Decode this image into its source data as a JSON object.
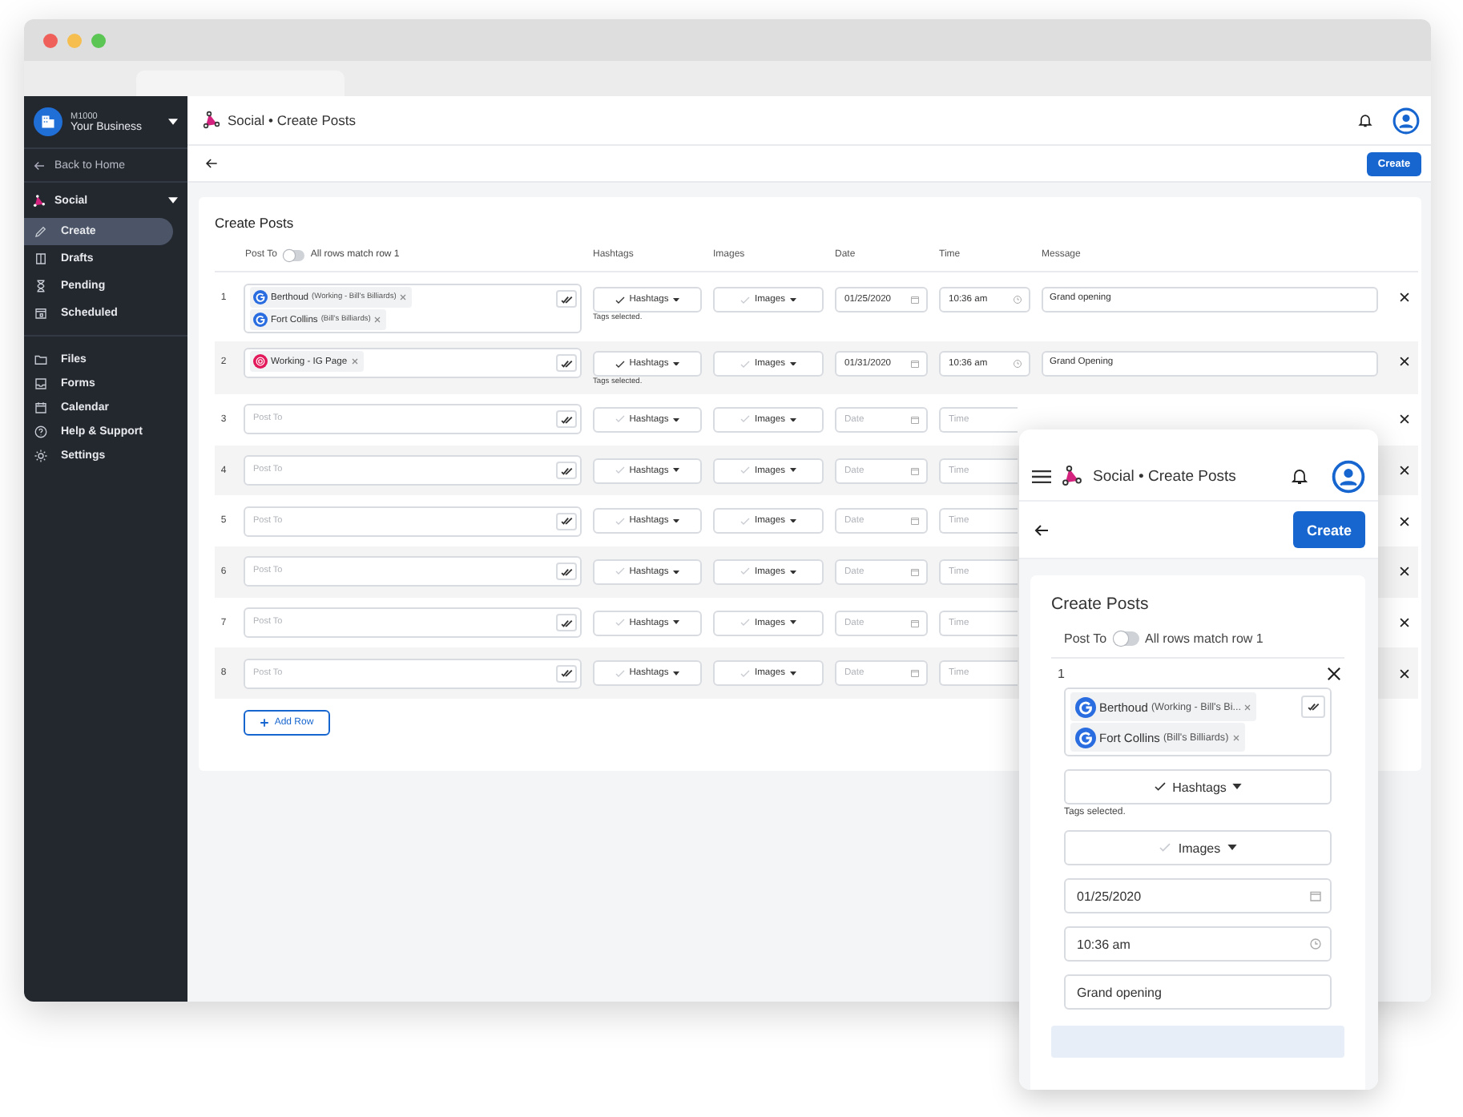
{
  "sidebar": {
    "business": {
      "code": "M1000",
      "name": "Your Business"
    },
    "back_link": "Back to Home",
    "section": "Social",
    "items": [
      {
        "label": "Create",
        "selected": true
      },
      {
        "label": "Drafts",
        "selected": false
      },
      {
        "label": "Pending",
        "selected": false
      },
      {
        "label": "Scheduled",
        "selected": false
      }
    ],
    "links": [
      "Files",
      "Forms",
      "Calendar",
      "Help & Support",
      "Settings"
    ]
  },
  "header": {
    "title": "Social • Create Posts"
  },
  "toolbar": {
    "create_button": "Create"
  },
  "posts": {
    "title": "Create Posts",
    "columns": {
      "post_to": "Post To",
      "hashtags": "Hashtags",
      "images": "Images",
      "date": "Date",
      "time": "Time",
      "message": "Message"
    },
    "match_toggle": {
      "label": "All rows match row 1",
      "on": false
    },
    "rows": [
      {
        "number": "1",
        "accounts": [
          {
            "kind": "google",
            "name": "Berthoud",
            "detail": "(Working - Bill's Billiards)"
          },
          {
            "kind": "google",
            "name": "Fort Collins",
            "detail": "(Bill's Billiards)"
          }
        ],
        "hashtags": {
          "label": "Hashtags",
          "checked": true
        },
        "tags_note": "Tags selected.",
        "images": {
          "label": "Images",
          "checked": false
        },
        "date": {
          "value": "01/25/2020"
        },
        "time": {
          "value": "10:36 am"
        },
        "message": {
          "value": "Grand opening"
        }
      },
      {
        "number": "2",
        "accounts": [
          {
            "kind": "instagram",
            "name": "Working - IG Page"
          }
        ],
        "hashtags": {
          "label": "Hashtags",
          "checked": true
        },
        "tags_note": "Tags selected.",
        "images": {
          "label": "Images",
          "checked": false
        },
        "date": {
          "value": "01/31/2020"
        },
        "time": {
          "value": "10:36 am"
        },
        "message": {
          "value": "Grand Opening"
        }
      },
      {
        "number": "3",
        "post_to_placeholder": "Post To",
        "hashtags": {
          "label": "Hashtags",
          "checked": false
        },
        "images": {
          "label": "Images",
          "checked": false
        },
        "date": {
          "placeholder": "Date"
        },
        "time": {
          "placeholder": "Time"
        }
      },
      {
        "number": "4",
        "post_to_placeholder": "Post To",
        "hashtags": {
          "label": "Hashtags",
          "checked": false
        },
        "images": {
          "label": "Images",
          "checked": false
        },
        "date": {
          "placeholder": "Date"
        },
        "time": {
          "placeholder": "Time"
        }
      },
      {
        "number": "5",
        "post_to_placeholder": "Post To",
        "hashtags": {
          "label": "Hashtags",
          "checked": false
        },
        "images": {
          "label": "Images",
          "checked": false
        },
        "date": {
          "placeholder": "Date"
        },
        "time": {
          "placeholder": "Time"
        }
      },
      {
        "number": "6",
        "post_to_placeholder": "Post To",
        "hashtags": {
          "label": "Hashtags",
          "checked": false
        },
        "images": {
          "label": "Images",
          "checked": false
        },
        "date": {
          "placeholder": "Date"
        },
        "time": {
          "placeholder": "Time"
        }
      },
      {
        "number": "7",
        "post_to_placeholder": "Post To",
        "hashtags": {
          "label": "Hashtags",
          "checked": false
        },
        "images": {
          "label": "Images",
          "checked": false
        },
        "date": {
          "placeholder": "Date"
        },
        "time": {
          "placeholder": "Time"
        }
      },
      {
        "number": "8",
        "post_to_placeholder": "Post To",
        "hashtags": {
          "label": "Hashtags",
          "checked": false
        },
        "images": {
          "label": "Images",
          "checked": false
        },
        "date": {
          "placeholder": "Date"
        },
        "time": {
          "placeholder": "Time"
        }
      }
    ],
    "add_row": "Add Row"
  },
  "mobile": {
    "title": "Social • Create Posts",
    "create_button": "Create",
    "card_title": "Create Posts",
    "post_to": "Post To",
    "match_toggle": {
      "label": "All rows match row 1",
      "on": false
    },
    "row": {
      "number": "1",
      "accounts": [
        {
          "kind": "google",
          "name": "Berthoud",
          "detail": "(Working - Bill's Bi..."
        },
        {
          "kind": "google",
          "name": "Fort Collins",
          "detail": "(Bill's Billiards)"
        }
      ],
      "hashtags": {
        "label": "Hashtags",
        "checked": true
      },
      "tags_note": "Tags selected.",
      "images": {
        "label": "Images",
        "checked": false
      },
      "date": {
        "value": "01/25/2020"
      },
      "time": {
        "value": "10:36 am"
      },
      "message": {
        "value": "Grand opening"
      }
    }
  }
}
